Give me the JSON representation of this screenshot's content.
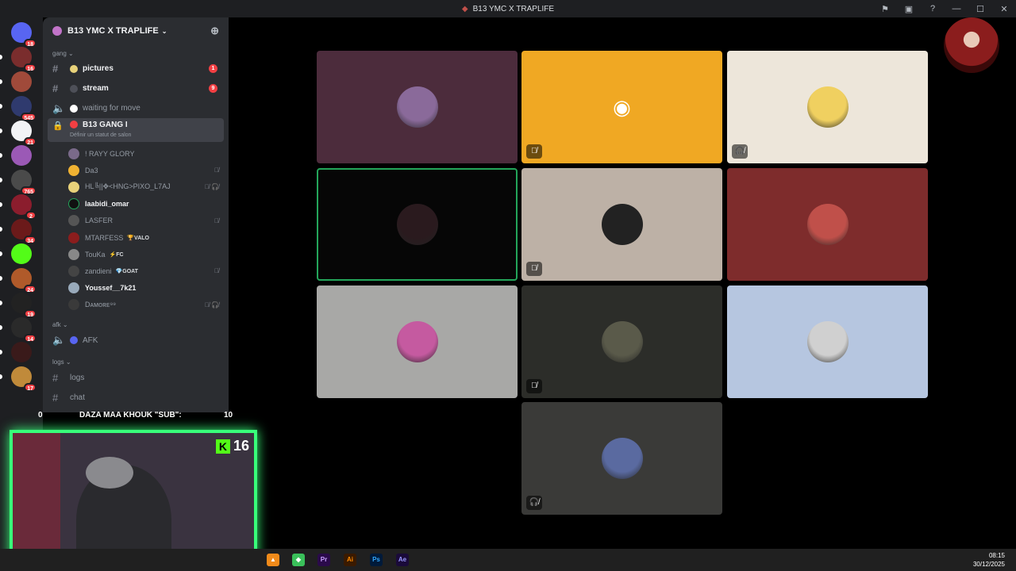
{
  "window": {
    "title": "B13 YMC X TRAPLIFE"
  },
  "servers": [
    {
      "badge": "18",
      "color": "#5865f2"
    },
    {
      "badge": "16",
      "color": "#7a2d2d"
    },
    {
      "badge": "",
      "color": "#a04a3a"
    },
    {
      "badge": "545",
      "color": "#2f3a6e"
    },
    {
      "badge": "21",
      "color": "#f2f3f5"
    },
    {
      "badge": "",
      "color": "#9b59b6"
    },
    {
      "badge": "765",
      "color": "#4a4a4a"
    },
    {
      "badge": "2",
      "color": "#8b1d2d"
    },
    {
      "badge": "34",
      "color": "#6b1a1a"
    },
    {
      "badge": "",
      "color": "#53fc18"
    },
    {
      "badge": "24",
      "color": "#b05a2a"
    },
    {
      "badge": "19",
      "color": "#222"
    },
    {
      "badge": "14",
      "color": "#2a2a2a"
    },
    {
      "badge": "",
      "color": "#3a1a1a"
    },
    {
      "badge": "17",
      "color": "#c08a3a"
    }
  ],
  "guild": {
    "name": "B13 YMC X TRAPLIFE"
  },
  "categories": {
    "gang": "gang",
    "afk": "afk",
    "logs": "logs"
  },
  "channels": {
    "pictures": {
      "label": "pictures",
      "badge": "1"
    },
    "stream": {
      "label": "stream",
      "badge": "9"
    },
    "waiting": {
      "label": "waiting for move"
    },
    "gang": {
      "label": "B13 GANG I",
      "status": "Définir un statut de salon"
    },
    "afk": {
      "label": "AFK"
    },
    "logs": {
      "label": "logs"
    },
    "chat": {
      "label": "chat"
    }
  },
  "voice_users": [
    {
      "name": "! RAYY GLORY",
      "tag": "",
      "color": "#7a6a8a",
      "icons": ""
    },
    {
      "name": "Da3",
      "tag": "",
      "color": "#f0b232",
      "icons": "🎙̸"
    },
    {
      "name": "HL╚||✥<HNG>PIXO_L7AJ",
      "tag": "",
      "color": "#e8d27a",
      "icons": "🎙̸ 🎧̸"
    },
    {
      "name": "laabidi_omar",
      "tag": "",
      "color": "#111",
      "icons": ""
    },
    {
      "name": "LASFER",
      "tag": "",
      "color": "#555",
      "icons": "🎙̸"
    },
    {
      "name": "MTARFESS",
      "tag": "🏆VALO",
      "color": "#8b1d1d",
      "icons": ""
    },
    {
      "name": "TouKa",
      "tag": "⚡FC",
      "color": "#888",
      "icons": ""
    },
    {
      "name": "zandieni",
      "tag": "💎GOAT",
      "color": "#444",
      "icons": "🎙̸"
    },
    {
      "name": "Youssef__7k21",
      "tag": "",
      "color": "#9ab",
      "icons": ""
    },
    {
      "name": "Dᴀᴍᴏʀᴇ⁹⁹",
      "tag": "",
      "color": "#3a3a3a",
      "icons": "🎙̸ 🎧̸"
    }
  ],
  "tiles": [
    {
      "bg": "#4c2c3c",
      "av": "#8a6a9a",
      "mute": ""
    },
    {
      "bg": "#f0a823",
      "av": "discord",
      "mute": "🎙̸"
    },
    {
      "bg": "#ede6da",
      "av": "#f0d060",
      "mute": "🎧̸"
    },
    {
      "bg": "#060606",
      "av": "#2a1a1e",
      "mute": "",
      "speak": true
    },
    {
      "bg": "#bdb1a6",
      "av": "#222",
      "mute": "🎙̸"
    },
    {
      "bg": "#7e2c2c",
      "av": "#c0504a",
      "mute": ""
    },
    {
      "bg": "#a8a8a6",
      "av": "#c55aa0",
      "mute": ""
    },
    {
      "bg": "#2c2d29",
      "av": "#5a5a4a",
      "mute": "🎙̸"
    },
    {
      "bg": "#b6c6e0",
      "av": "#d0d0d0",
      "mute": ""
    },
    {
      "bg": "#3a3a38",
      "av": "#5a6aa0",
      "mute": "🎧̸"
    }
  ],
  "stream_overlay": {
    "sub_text": "DAZA MAA KHOUK \"SUB\":",
    "sub_count": "10",
    "left_count": "0",
    "kick_viewers": "16"
  },
  "taskbar": {
    "time": "08:15",
    "date": "30/12/2025",
    "apps": [
      "Pr",
      "Ai",
      "Ps",
      "Ae"
    ]
  }
}
